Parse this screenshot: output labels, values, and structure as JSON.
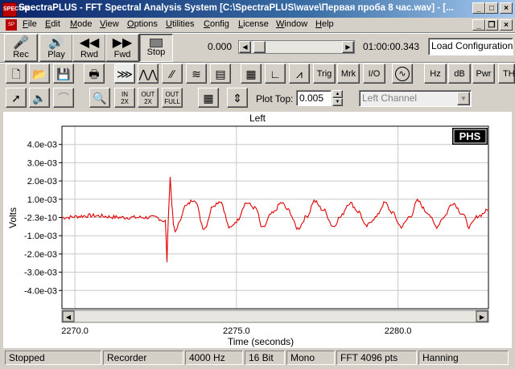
{
  "window": {
    "app_icon": "SPECTRA",
    "title": "SpectraPLUS - FFT Spectral Analysis System [C:\\SpectraPLUS\\wave\\Первая проба 8 час.wav] - [...",
    "controls": [
      "minimize-icon",
      "maximize-icon",
      "close-icon"
    ]
  },
  "menu": {
    "items": [
      "File",
      "Edit",
      "Mode",
      "View",
      "Options",
      "Utilities",
      "Config",
      "License",
      "Window",
      "Help"
    ],
    "mdi_controls": [
      "minimize-icon",
      "restore-icon",
      "close-icon"
    ]
  },
  "toolbar1": {
    "transport": [
      {
        "label": "Rec",
        "icon": "microphone-icon"
      },
      {
        "label": "Play",
        "icon": "speaker-icon"
      },
      {
        "label": "Rwd",
        "icon": "rewind-icon"
      },
      {
        "label": "Fwd",
        "icon": "forward-icon"
      },
      {
        "label": "Stop",
        "icon": "stop-icon"
      }
    ],
    "position_value": "0.000",
    "time_readout": "01:00:00.343",
    "load_config_label": "Load Configuration"
  },
  "toolbar2": {
    "text_buttons": [
      "Trig",
      "Mrk",
      "I/O",
      "Hz",
      "dB",
      "Pwr",
      "TH"
    ]
  },
  "toolbar3": {
    "zoom_in": {
      "line1": "IN",
      "line2": "2X"
    },
    "zoom_out": {
      "line1": "OUT",
      "line2": "2X"
    },
    "zoom_full": {
      "line1": "OUT",
      "line2": "FULL"
    },
    "plot_top_label": "Plot Top:",
    "plot_top_value": "0.005",
    "channel_select": "Left Channel"
  },
  "plot": {
    "channel_title": "Left",
    "badge": "PHS",
    "status_colors": {
      "trace": "#e00000",
      "grid": "#c8c8c8"
    }
  },
  "chart_data": {
    "type": "line",
    "title": "Left",
    "xlabel": "Time (seconds)",
    "ylabel": "Volts",
    "xlim": [
      2269.6,
      2282.8
    ],
    "ylim": [
      -0.005,
      0.005
    ],
    "y_ticks": [
      "4.0e-03",
      "3.0e-03",
      "2.0e-03",
      "1.0e-03",
      "-2.3e-10",
      "-1.0e-03",
      "-2.0e-03",
      "-3.0e-03",
      "-4.0e-03"
    ],
    "x_ticks": [
      "2270.0",
      "2275.0",
      "2280.0"
    ],
    "x_tick_values": [
      2270.0,
      2275.0,
      2280.0
    ],
    "grid": true,
    "series": [
      {
        "color": "#e00000",
        "x": [
          2269.6,
          2270.5,
          2271.5,
          2272.5,
          2272.8,
          2272.85,
          2272.9,
          2272.95,
          2273.0,
          2273.05,
          2273.1,
          2273.2,
          2273.4,
          2273.7,
          2274.0,
          2274.3,
          2274.5,
          2274.8,
          2275.0,
          2275.3,
          2275.6,
          2275.8,
          2276.1,
          2276.4,
          2276.6,
          2276.9,
          2277.2,
          2277.4,
          2277.7,
          2278.0,
          2278.2,
          2278.5,
          2278.8,
          2279.0,
          2279.3,
          2279.6,
          2279.8,
          2280.1,
          2280.4,
          2280.6,
          2280.9,
          2281.2,
          2281.4,
          2281.7,
          2282.0,
          2282.2,
          2282.5,
          2282.8
        ],
        "y": [
          0.0,
          0.0001,
          0.0,
          0.0,
          -0.0002,
          -0.0024,
          0.0004,
          0.0022,
          0.0008,
          -0.0004,
          -0.0008,
          -0.0004,
          0.0006,
          0.001,
          -0.0006,
          0.0007,
          0.0009,
          -0.0006,
          -0.0002,
          0.0008,
          0.0005,
          -0.0006,
          0.0002,
          0.0008,
          0.0004,
          -0.0006,
          0.0001,
          0.0009,
          0.0004,
          -0.0005,
          0.0,
          0.0008,
          0.0003,
          -0.0005,
          0.0,
          0.0008,
          0.0003,
          -0.0005,
          0.0001,
          0.0009,
          0.0003,
          -0.0005,
          0.0,
          0.0008,
          0.0002,
          -0.0005,
          0.0001,
          0.0004
        ]
      }
    ]
  },
  "status": [
    "Stopped",
    "Recorder",
    "4000 Hz",
    "16 Bit",
    "Mono",
    "FFT 4096 pts",
    "Hanning"
  ]
}
